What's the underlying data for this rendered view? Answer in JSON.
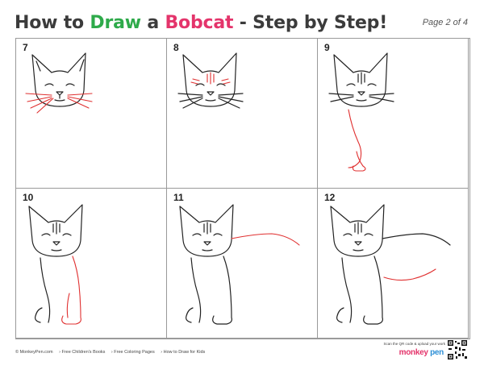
{
  "header": {
    "title_parts": [
      "How to ",
      "Draw",
      " a ",
      "Bobcat",
      " - Step by Step!"
    ],
    "page": "Page 2 of 4"
  },
  "steps": [
    "7",
    "8",
    "9",
    "10",
    "11",
    "12"
  ],
  "footer": {
    "links": [
      "© MonkeyPen.com",
      "› Free Children's Books",
      "› Free Coloring Pages",
      "› How to Draw for Kids"
    ],
    "scan_text": "Scan the QR code & upload your work",
    "logo_parts": [
      "monkey",
      "pen"
    ]
  },
  "colors": {
    "accent_green": "#2eaa4a",
    "accent_pink": "#e4346b",
    "new_stroke": "#e03030",
    "line": "#222222"
  }
}
